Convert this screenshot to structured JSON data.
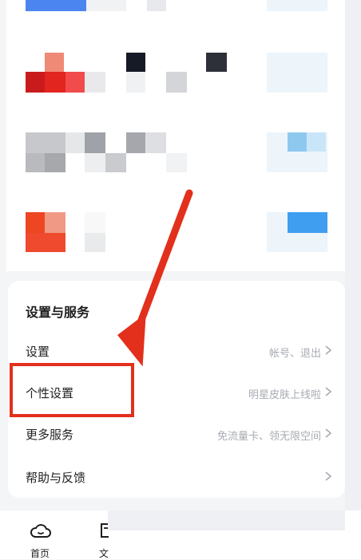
{
  "settings": {
    "title": "设置与服务",
    "items": [
      {
        "label": "设置",
        "hint": "帐号、退出"
      },
      {
        "label": "个性设置",
        "hint": "明星皮肤上线啦"
      },
      {
        "label": "更多服务",
        "hint": "免流量卡、领无限空间"
      },
      {
        "label": "帮助与反馈",
        "hint": ""
      }
    ]
  },
  "bottom_nav": {
    "tabs": [
      {
        "label": "首页",
        "icon": "cloud-home-icon"
      },
      {
        "label": "文",
        "icon": "document-icon"
      }
    ]
  },
  "colors": {
    "highlight": "#e2301c",
    "accent_blue": "#3f9ef0"
  }
}
